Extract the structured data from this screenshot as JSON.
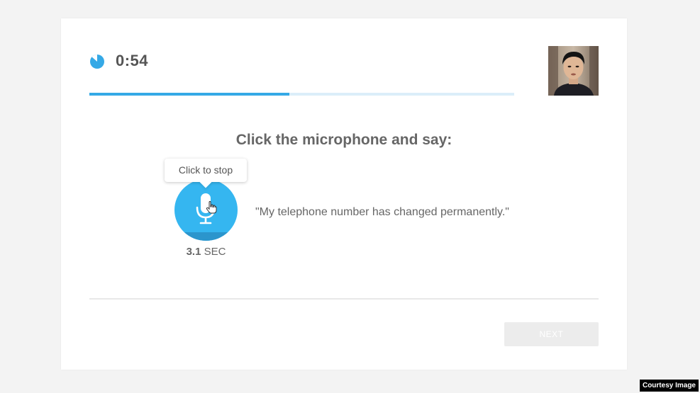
{
  "timer": {
    "time": "0:54",
    "progress": 0.47
  },
  "prompt": {
    "heading": "Click the microphone and say:",
    "phrase": "\"My telephone number has changed permanently.\""
  },
  "mic": {
    "tooltip": "Click to stop",
    "elapsed_value": "3.1",
    "elapsed_unit": "SEC"
  },
  "actions": {
    "next_label": "NEXT"
  },
  "credit": "Courtesy Image",
  "colors": {
    "accent": "#35b6f0",
    "accent_dark": "#2b95cc",
    "progress_track": "#dbeef9",
    "disabled_button": "#ececec"
  },
  "icons": {
    "timer": "pie-timer-icon",
    "microphone": "microphone-icon",
    "cursor": "hand-cursor-icon"
  }
}
